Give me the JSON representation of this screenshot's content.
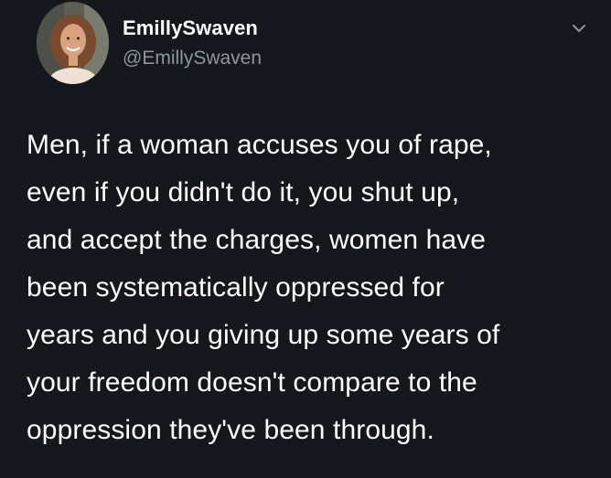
{
  "tweet": {
    "author": {
      "display_name": "EmillySwaven",
      "handle": "@EmillySwaven",
      "avatar_icon": "profile-photo"
    },
    "menu_icon": "chevron-down-icon",
    "text": "Men, if a woman accuses you of rape,\neven if you didn't do it, you shut up,\nand accept the charges, women have\nbeen systematically oppressed for\nyears and you giving up some years of\nyour freedom doesn't compare to the\noppression they've been through."
  },
  "colors": {
    "background": "#14171c",
    "primary_text": "#ffffff",
    "secondary_text": "#8e959d"
  }
}
